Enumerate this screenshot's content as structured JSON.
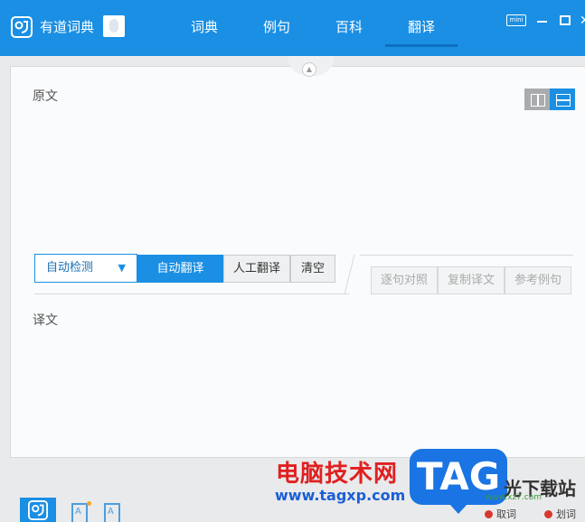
{
  "app": {
    "name": "有道词典"
  },
  "tabs": [
    {
      "label": "词典",
      "active": false
    },
    {
      "label": "例句",
      "active": false
    },
    {
      "label": "百科",
      "active": false
    },
    {
      "label": "翻译",
      "active": true
    }
  ],
  "window_controls": {
    "mini_label": "mini"
  },
  "translate": {
    "source_label": "原文",
    "target_label": "译文",
    "language_select": "自动检测",
    "auto_translate_button": "自动翻译",
    "human_translate_button": "人工翻译",
    "clear_button": "清空",
    "sentence_align_button": "逐句对照",
    "copy_translation_button": "复制译文",
    "reference_examples_button": "参考例句"
  },
  "bottom": {
    "word_fetch": "取词",
    "word_select": "划词"
  },
  "watermark": {
    "site_name": "电脑技术网",
    "url": "www.tagxp.com",
    "badge": "TAG",
    "tail": "光下载站",
    "small": "www.xz7.com"
  },
  "colors": {
    "accent": "#1a8fe3",
    "watermark_red": "#e02020"
  }
}
